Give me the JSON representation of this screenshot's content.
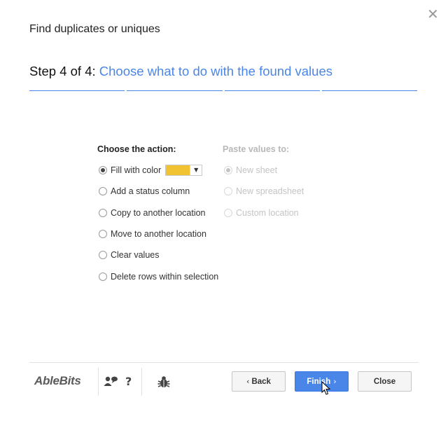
{
  "dialog": {
    "title": "Find duplicates or uniques",
    "close_glyph": "✕"
  },
  "step": {
    "number_label": "Step 4 of 4:",
    "description": "Choose what to do with the found values",
    "progress_segments": 4,
    "progress_color": "#4a86e8"
  },
  "action_section": {
    "heading": "Choose the action:",
    "options": [
      {
        "label": "Fill with color",
        "checked": true
      },
      {
        "label": "Add a status column",
        "checked": false
      },
      {
        "label": "Copy to another location",
        "checked": false
      },
      {
        "label": "Move to another location",
        "checked": false
      },
      {
        "label": "Clear values",
        "checked": false
      },
      {
        "label": "Delete rows within selection",
        "checked": false
      }
    ],
    "fill_color": "#f1c232",
    "dropdown_arrow": "▼"
  },
  "paste_section": {
    "heading": "Paste values to:",
    "disabled": true,
    "options": [
      {
        "label": "New sheet",
        "checked": true
      },
      {
        "label": "New spreadsheet",
        "checked": false
      },
      {
        "label": "Custom location",
        "checked": false
      }
    ]
  },
  "footer": {
    "logo": "AbleBits",
    "support_icon": "support-chat-icon",
    "help_icon": "question-mark-icon",
    "help_glyph": "?",
    "bug_icon": "bug-icon",
    "back_label": "Back",
    "finish_label": "Finish",
    "close_label": "Close",
    "back_chevron": "‹",
    "finish_chevron": "›",
    "accent": "#4a86e8"
  }
}
